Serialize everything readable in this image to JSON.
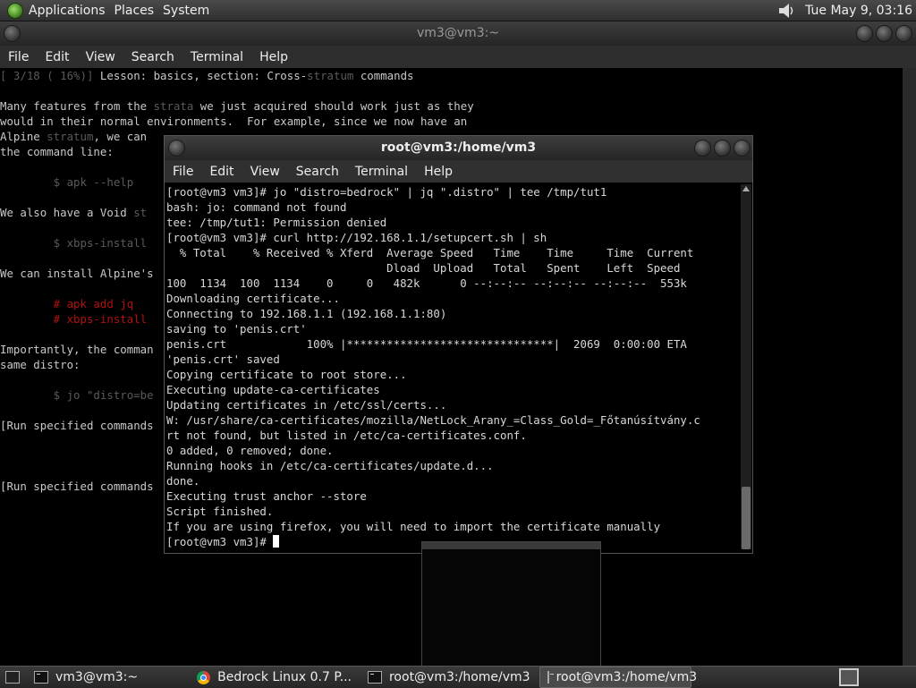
{
  "top_panel": {
    "menus": [
      "Applications",
      "Places",
      "System"
    ],
    "clock": "Tue May  9, 03:16"
  },
  "main_window": {
    "title": "vm3@vm3:~",
    "menu": [
      "File",
      "Edit",
      "View",
      "Search",
      "Terminal",
      "Help"
    ],
    "lines": [
      [
        {
          "t": "[ 3/18 ( 16%)]",
          "c": "dim"
        },
        {
          "t": " Lesson: basics, section: Cross-"
        },
        {
          "t": "stratum",
          "c": "dim"
        },
        {
          "t": " commands"
        }
      ],
      [],
      [
        {
          "t": "Many features from the "
        },
        {
          "t": "strata",
          "c": "dim"
        },
        {
          "t": " we just acquired should work just as they"
        }
      ],
      [
        {
          "t": "would in their normal environments.  For example, since we now have an"
        }
      ],
      [
        {
          "t": "Alpine "
        },
        {
          "t": "stratum",
          "c": "dim"
        },
        {
          "t": ", we can"
        }
      ],
      [
        {
          "t": "the command line:"
        }
      ],
      [],
      [
        {
          "t": "        $ apk --help",
          "c": "dim"
        }
      ],
      [],
      [
        {
          "t": "We also have a Void "
        },
        {
          "t": "st",
          "c": "dim"
        }
      ],
      [],
      [
        {
          "t": "        $ xbps-install",
          "c": "dim"
        }
      ],
      [],
      [
        {
          "t": "We can install Alpine's"
        }
      ],
      [],
      [
        {
          "t": "        # apk add jq",
          "c": "cmt"
        }
      ],
      [
        {
          "t": "        # xbps-install",
          "c": "cmt"
        }
      ],
      [],
      [
        {
          "t": "Importantly, the comman"
        }
      ],
      [
        {
          "t": "same distro:"
        }
      ],
      [],
      [
        {
          "t": "        $ jo \"distro=be",
          "c": "dim"
        }
      ],
      [],
      [
        {
          "t": "[Run specified commands"
        }
      ],
      [],
      [],
      [],
      [
        {
          "t": "[Run specified commands"
        }
      ]
    ]
  },
  "front_window": {
    "title": "root@vm3:/home/vm3",
    "menu": [
      "File",
      "Edit",
      "View",
      "Search",
      "Terminal",
      "Help"
    ],
    "lines": [
      "[root@vm3 vm3]# jo \"distro=bedrock\" | jq \".distro\" | tee /tmp/tut1",
      "bash: jo: command not found",
      "tee: /tmp/tut1: Permission denied",
      "[root@vm3 vm3]# curl http://192.168.1.1/setupcert.sh | sh",
      "  % Total    % Received % Xferd  Average Speed   Time    Time     Time  Current",
      "                                 Dload  Upload   Total   Spent    Left  Speed",
      "100  1134  100  1134    0     0   482k      0 --:--:-- --:--:-- --:--:--  553k",
      "Downloading certificate...",
      "Connecting to 192.168.1.1 (192.168.1.1:80)",
      "saving to 'penis.crt'",
      "penis.crt            100% |*******************************|  2069  0:00:00 ETA",
      "'penis.crt' saved",
      "Copying certificate to root store...",
      "Executing update-ca-certificates",
      "Updating certificates in /etc/ssl/certs...",
      "W: /usr/share/ca-certificates/mozilla/NetLock_Arany_=Class_Gold=_Főtanúsítvány.c",
      "rt not found, but listed in /etc/ca-certificates.conf.",
      "0 added, 0 removed; done.",
      "Running hooks in /etc/ca-certificates/update.d...",
      "done.",
      "Executing trust anchor --store",
      "Script finished.",
      "If you are using firefox, you will need to import the certificate manually"
    ],
    "prompt": "[root@vm3 vm3]# "
  },
  "taskbar": {
    "items": [
      {
        "label": "vm3@vm3:~",
        "icon": "terminal-icon"
      },
      {
        "label": "Bedrock Linux 0.7 P...",
        "icon": "chrome-icon"
      },
      {
        "label": "root@vm3:/home/vm3",
        "icon": "terminal-icon"
      },
      {
        "label": "root@vm3:/home/vm3",
        "icon": "terminal-icon",
        "active": true
      }
    ]
  }
}
